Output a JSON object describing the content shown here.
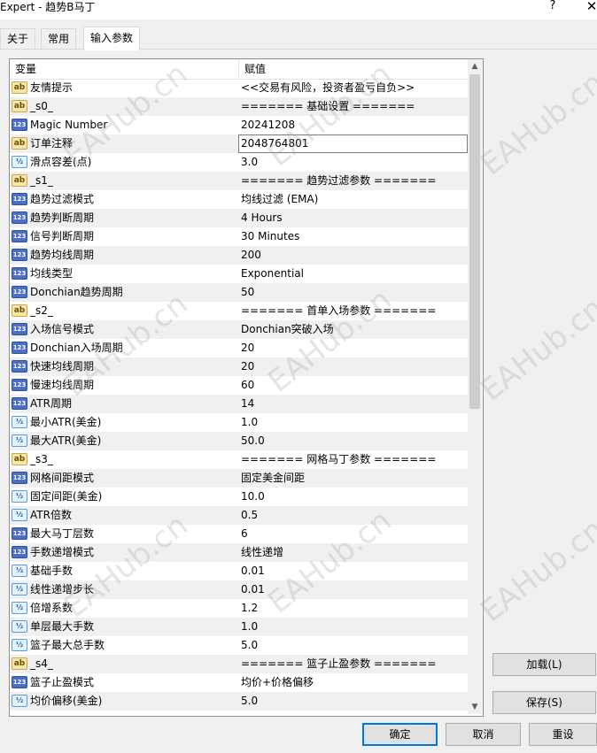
{
  "window": {
    "title": "Expert - 趋势B马丁",
    "help_label": "?",
    "close_label": "✕"
  },
  "tabs": [
    {
      "label": "关于"
    },
    {
      "label": "常用"
    },
    {
      "label": "输入参数"
    }
  ],
  "grid": {
    "header_variable": "变量",
    "header_value": "赋值",
    "rows": [
      {
        "icon": "ab",
        "name": "友情提示",
        "value": "<<交易有风险，投资者盈亏自负>>"
      },
      {
        "icon": "ab",
        "name": "_s0_",
        "value": "======= 基础设置 ======="
      },
      {
        "icon": "123",
        "name": "Magic Number",
        "value": "20241208"
      },
      {
        "icon": "ab",
        "name": "订单注释",
        "value": "2048764801"
      },
      {
        "icon": "v2",
        "name": "滑点容差(点)",
        "value": "3.0"
      },
      {
        "icon": "ab",
        "name": "_s1_",
        "value": "======= 趋势过滤参数 ======="
      },
      {
        "icon": "123",
        "name": "趋势过滤模式",
        "value": "均线过滤 (EMA)"
      },
      {
        "icon": "123",
        "name": "趋势判断周期",
        "value": "4 Hours"
      },
      {
        "icon": "123",
        "name": "信号判断周期",
        "value": "30 Minutes"
      },
      {
        "icon": "123",
        "name": "趋势均线周期",
        "value": "200"
      },
      {
        "icon": "123",
        "name": "均线类型",
        "value": "Exponential"
      },
      {
        "icon": "123",
        "name": "Donchian趋势周期",
        "value": "50"
      },
      {
        "icon": "ab",
        "name": "_s2_",
        "value": "======= 首单入场参数 ======="
      },
      {
        "icon": "123",
        "name": "入场信号模式",
        "value": "Donchian突破入场"
      },
      {
        "icon": "123",
        "name": "Donchian入场周期",
        "value": "20"
      },
      {
        "icon": "123",
        "name": "快速均线周期",
        "value": "20"
      },
      {
        "icon": "123",
        "name": "慢速均线周期",
        "value": "60"
      },
      {
        "icon": "123",
        "name": "ATR周期",
        "value": "14"
      },
      {
        "icon": "v2",
        "name": "最小ATR(美金)",
        "value": "1.0"
      },
      {
        "icon": "v2",
        "name": "最大ATR(美金)",
        "value": "50.0"
      },
      {
        "icon": "ab",
        "name": "_s3_",
        "value": "======= 网格马丁参数 ======="
      },
      {
        "icon": "123",
        "name": "网格间距模式",
        "value": "固定美金间距"
      },
      {
        "icon": "v2",
        "name": "固定间距(美金)",
        "value": "10.0"
      },
      {
        "icon": "v2",
        "name": "ATR倍数",
        "value": "0.5"
      },
      {
        "icon": "123",
        "name": "最大马丁层数",
        "value": "6"
      },
      {
        "icon": "123",
        "name": "手数递增模式",
        "value": "线性递增"
      },
      {
        "icon": "v2",
        "name": "基础手数",
        "value": "0.01"
      },
      {
        "icon": "v2",
        "name": "线性递增步长",
        "value": "0.01"
      },
      {
        "icon": "v2",
        "name": "倍增系数",
        "value": "1.2"
      },
      {
        "icon": "v2",
        "name": "单层最大手数",
        "value": "1.0"
      },
      {
        "icon": "v2",
        "name": "篮子最大总手数",
        "value": "5.0"
      },
      {
        "icon": "ab",
        "name": "_s4_",
        "value": "======= 篮子止盈参数 ======="
      },
      {
        "icon": "123",
        "name": "篮子止盈模式",
        "value": "均价+价格偏移"
      },
      {
        "icon": "v2",
        "name": "均价偏移(美金)",
        "value": "5.0"
      }
    ]
  },
  "buttons": {
    "load": "加载(L)",
    "save": "保存(S)",
    "ok": "确定",
    "cancel": "取消",
    "reset": "重设"
  },
  "icon_text": {
    "ab": "ab",
    "123": "123",
    "v2": "½"
  },
  "watermark": "EAHub.cn"
}
